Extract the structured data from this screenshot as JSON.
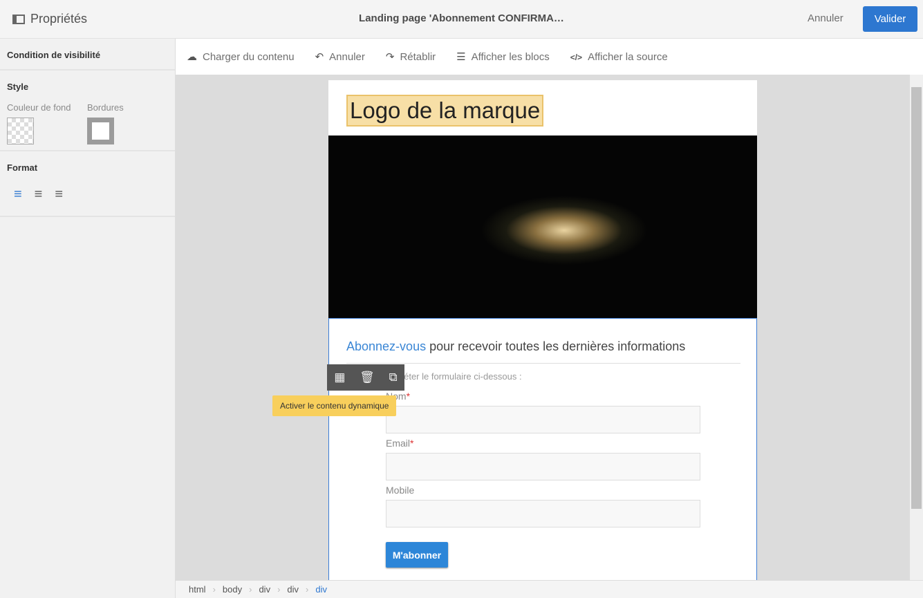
{
  "header": {
    "panel_title": "Propriétés",
    "page_title": "Landing page 'Abonnement CONFIRMA…",
    "cancel": "Annuler",
    "validate": "Valider"
  },
  "sidebar": {
    "visibility": "Condition de visibilité",
    "style": "Style",
    "bg_color": "Couleur de fond",
    "borders": "Bordures",
    "format": "Format"
  },
  "toolbar": {
    "load": "Charger du contenu",
    "undo": "Annuler",
    "redo": "Rétablir",
    "blocks": "Afficher les blocs",
    "source": "Afficher la source"
  },
  "content": {
    "logo": "Logo de la marque",
    "heading_link": "Abonnez-vous",
    "heading_rest": " pour recevoir toutes les dernières informations",
    "intro": "Veuillez compléter le formulaire ci-dessous :",
    "fields": [
      {
        "label": "Nom",
        "required": "*"
      },
      {
        "label": "Email",
        "required": "*"
      },
      {
        "label": "Mobile"
      }
    ],
    "submit": "M'abonner"
  },
  "tooltip": "Activer le contenu dynamique",
  "breadcrumb": [
    "html",
    "body",
    "div",
    "div",
    "div"
  ],
  "colors": {
    "accent": "#2d77d0",
    "tooltip": "#f8cf5c"
  }
}
